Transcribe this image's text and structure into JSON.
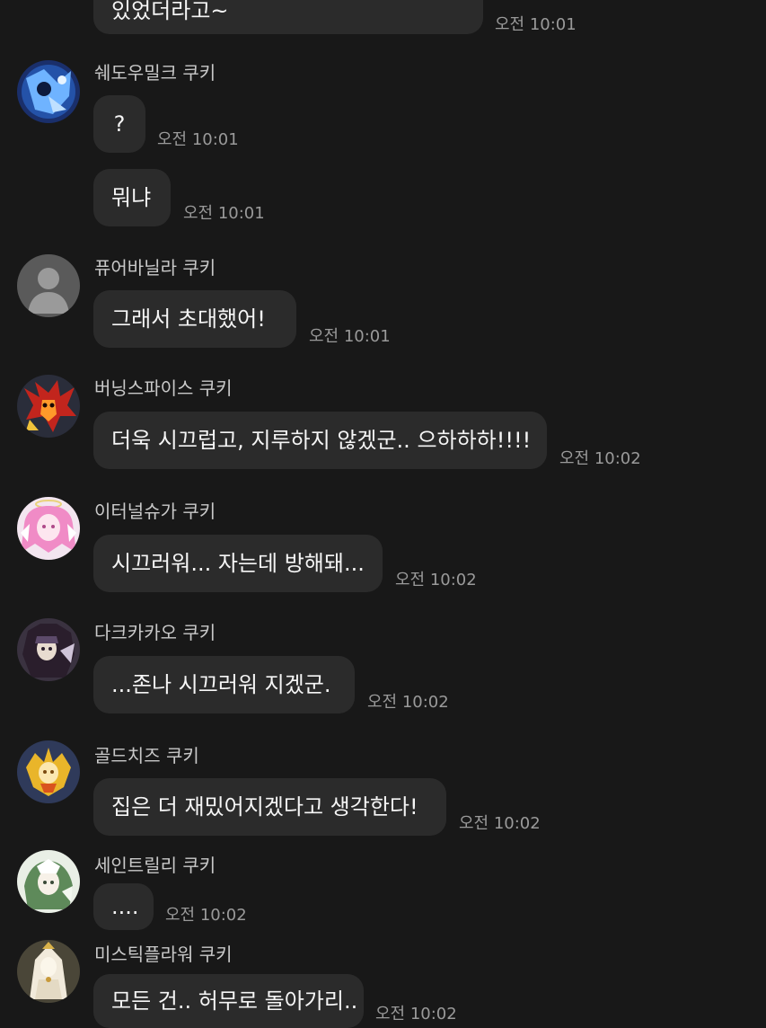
{
  "messages": [
    {
      "text": "있었더라고~",
      "time": "오전 10:01"
    },
    {
      "sender": "쉐도우밀크 쿠키",
      "avatar_icon": "shadow-milk-avatar-icon",
      "text": "?",
      "time": "오전 10:01"
    },
    {
      "text": "뭐냐",
      "time": "오전 10:01"
    },
    {
      "sender": "퓨어바닐라 쿠키",
      "avatar_icon": "default-profile-icon",
      "text": "그래서 초대했어!",
      "time": "오전 10:01"
    },
    {
      "sender": "버닝스파이스 쿠키",
      "avatar_icon": "burning-spice-avatar-icon",
      "text": "더욱 시끄럽고, 지루하지 않겠군.. 으하하하!!!!",
      "time": "오전 10:02"
    },
    {
      "sender": "이터널슈가 쿠키",
      "avatar_icon": "eternal-sugar-avatar-icon",
      "text": "시끄러워... 자는데 방해돼...",
      "time": "오전 10:02"
    },
    {
      "sender": "다크카카오 쿠키",
      "avatar_icon": "dark-cacao-avatar-icon",
      "text": "...존나 시끄러워 지겠군.",
      "time": "오전 10:02"
    },
    {
      "sender": "골드치즈 쿠키",
      "avatar_icon": "golden-cheese-avatar-icon",
      "text": "집은 더 재밌어지겠다고 생각한다!",
      "time": "오전 10:02"
    },
    {
      "sender": "세인트릴리 쿠키",
      "avatar_icon": "saint-lily-avatar-icon",
      "text": "....",
      "time": "오전 10:02"
    },
    {
      "sender": "미스틱플라워 쿠키",
      "avatar_icon": "mystic-flower-avatar-icon",
      "text": "모든 건.. 허무로 돌아가리..",
      "time": "오전 10:02"
    }
  ],
  "colors": {
    "background": "#181818",
    "bubble": "#2b2b2b",
    "text": "#f5f5f5",
    "timestamp": "#9a9a9a",
    "sender": "#c9c9c9"
  }
}
